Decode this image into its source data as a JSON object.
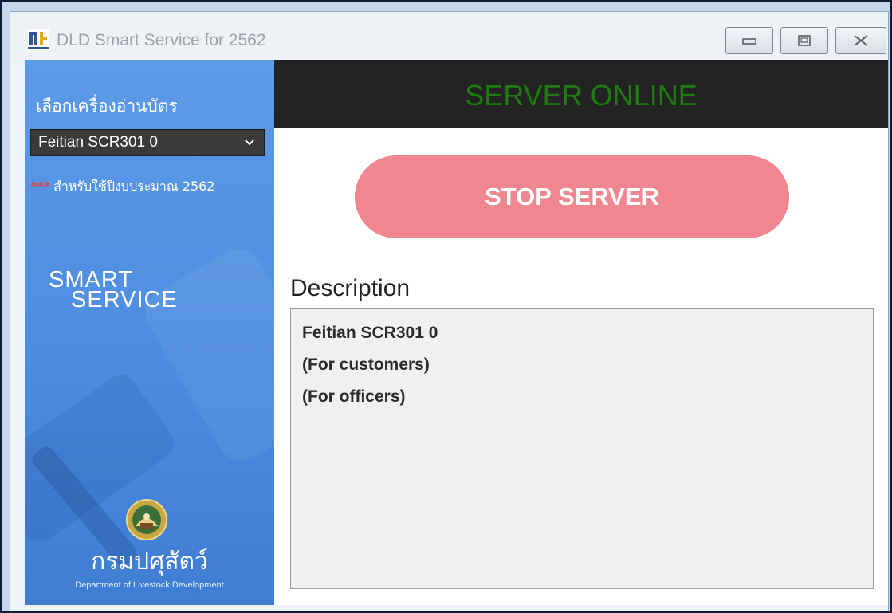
{
  "window": {
    "title": "DLD Smart Service for 2562"
  },
  "sidebar": {
    "reader_label": "เลือกเครื่องอ่านบัตร",
    "reader_select_value": "Feitian SCR301 0",
    "budget_note_stars": "***",
    "budget_note": "สำหรับใช้ปีงบประมาณ 2562",
    "logo_line1": "SMART",
    "logo_line2": "SERVICE",
    "dept_name_thai": "กรมปศุสัตว์",
    "dept_name_eng": "Department of Livestock Development"
  },
  "main": {
    "server_status": "SERVER ONLINE",
    "server_status_color": "#1f7a12",
    "stop_button_label": "STOP SERVER",
    "stop_button_color": "#f0868f",
    "description_title": "Description",
    "description_lines": [
      "Feitian SCR301 0",
      "(For customers)",
      "(For officers)"
    ]
  }
}
